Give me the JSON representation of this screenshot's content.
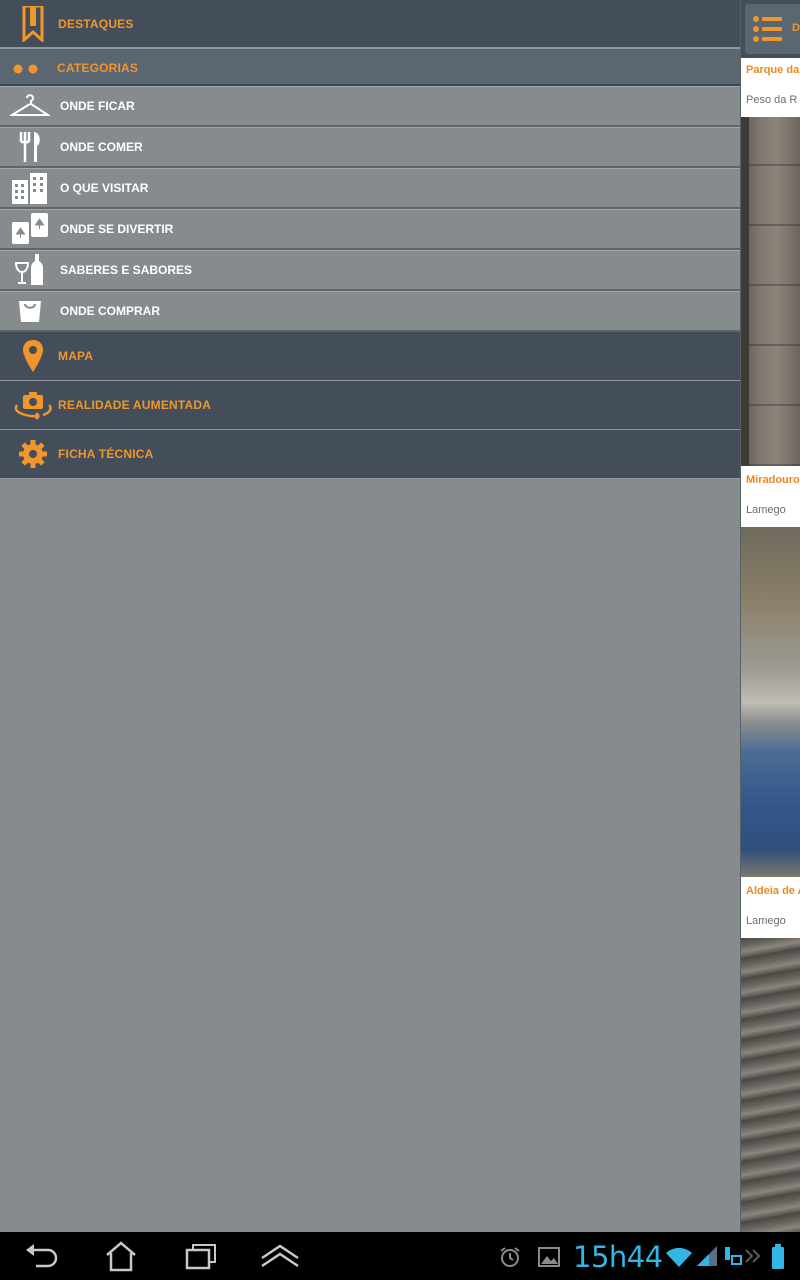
{
  "drawer": {
    "destaques": {
      "label": "DESTAQUES",
      "icon": "bookmark-icon"
    },
    "categorias": {
      "label": "CATEGORIAS",
      "icon": "dots-icon"
    },
    "categories": [
      {
        "label": "ONDE FICAR",
        "icon": "hanger-icon"
      },
      {
        "label": "ONDE COMER",
        "icon": "fork-knife-icon"
      },
      {
        "label": "O QUE VISITAR",
        "icon": "buildings-icon"
      },
      {
        "label": "ONDE SE DIVERTIR",
        "icon": "playing-cards-icon"
      },
      {
        "label": "SABERES E SABORES",
        "icon": "wine-bottle-icon"
      },
      {
        "label": "ONDE COMPRAR",
        "icon": "shopping-bag-icon"
      }
    ],
    "mapa": {
      "label": "MAPA",
      "icon": "map-pin-icon"
    },
    "realidade": {
      "label": "REALIDADE AUMENTADA",
      "icon": "rotate-camera-icon"
    },
    "ficha": {
      "label": "FICHA TÉCNICA",
      "icon": "gear-icon"
    }
  },
  "content": {
    "header_label": "D",
    "cards": [
      {
        "title": "Parque da",
        "subtitle": "Peso da R"
      },
      {
        "title": "Miradouro",
        "subtitle": "Lamego"
      },
      {
        "title": "Aldeia de A",
        "subtitle": "Lamego"
      }
    ]
  },
  "status_bar": {
    "time": "15h44",
    "icons": [
      "alarm-icon",
      "gallery-icon",
      "wifi-icon",
      "signal-icon",
      "download-icon",
      "battery-icon"
    ]
  },
  "nav_bar": {
    "buttons": [
      "back-icon",
      "home-icon",
      "recent-apps-icon",
      "menu-up-icon"
    ]
  },
  "colors": {
    "accent": "#f0962a",
    "drawer_dark": "#434e5a",
    "drawer_gray": "#868b8e",
    "clock": "#33b5e5"
  }
}
